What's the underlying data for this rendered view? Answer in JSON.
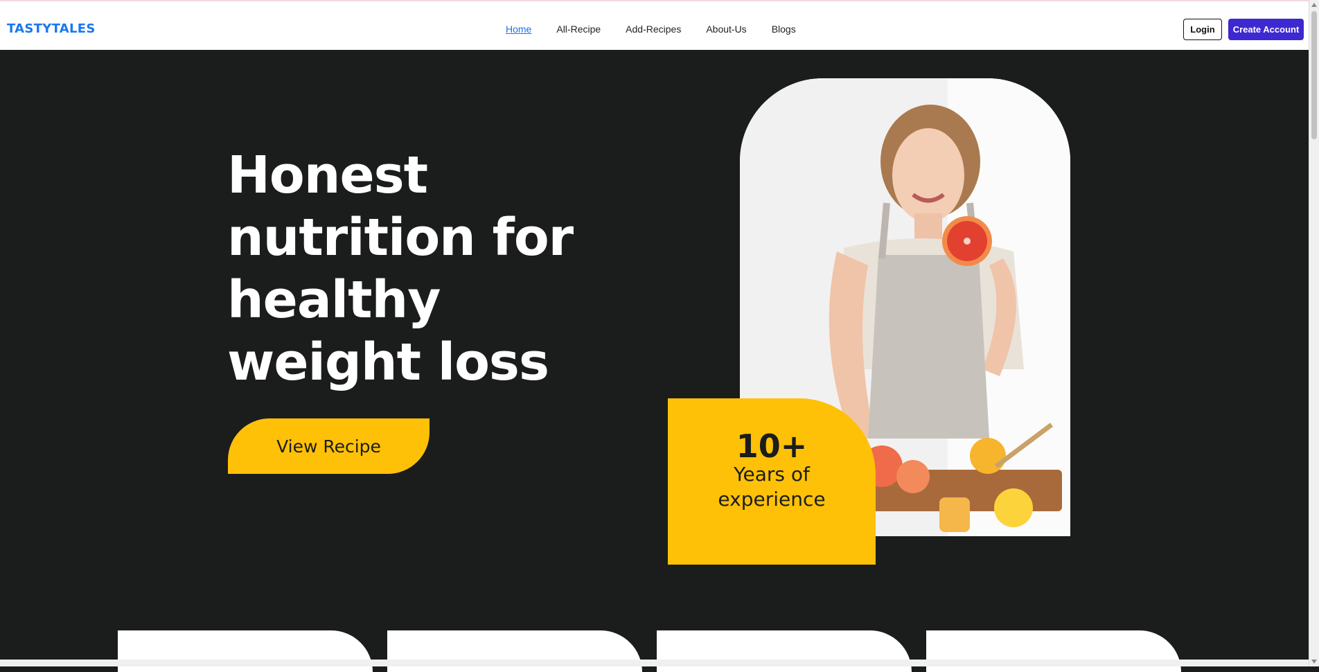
{
  "brand": {
    "name": "TASTYTALES"
  },
  "nav": {
    "links": [
      {
        "label": "Home",
        "active": true
      },
      {
        "label": "All-Recipe"
      },
      {
        "label": "Add-Recipes"
      },
      {
        "label": "About-Us"
      },
      {
        "label": "Blogs"
      }
    ],
    "login_label": "Login",
    "create_label": "Create Account"
  },
  "hero": {
    "title": "Honest nutrition for healthy weight loss",
    "cta_label": "View Recipe",
    "experience_number": "10+",
    "experience_text_line1": "Years of",
    "experience_text_line2": "experience"
  },
  "colors": {
    "background": "#1b1d1c",
    "accent": "#fec107",
    "brand_blue": "#1877f2",
    "create_button": "#3d28d1"
  }
}
